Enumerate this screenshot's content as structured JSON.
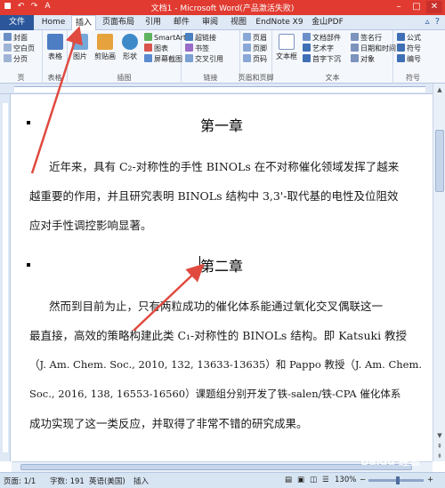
{
  "window": {
    "title": "文档1 - Microsoft Word(产品激活失败)",
    "controls": [
      "minimize",
      "restore",
      "close"
    ]
  },
  "quick_access": [
    "save-icon",
    "undo-icon",
    "redo-icon",
    "format-icon"
  ],
  "tabs": [
    {
      "label": "文件"
    },
    {
      "label": "Home"
    },
    {
      "label": "插入"
    },
    {
      "label": "页面布局"
    },
    {
      "label": "引用"
    },
    {
      "label": "邮件"
    },
    {
      "label": "审阅"
    },
    {
      "label": "视图"
    },
    {
      "label": "EndNote X9"
    },
    {
      "label": "金山PDF"
    }
  ],
  "active_tab": "插入",
  "ribbon": {
    "pages": {
      "label": "页",
      "items": [
        "封面",
        "空白页",
        "分页"
      ]
    },
    "tables": {
      "label": "表格",
      "items": [
        "表格"
      ]
    },
    "illustrations": {
      "label": "插图",
      "items": [
        "图片",
        "剪贴画",
        "形状",
        "SmartArt",
        "图表",
        "屏幕截图"
      ]
    },
    "links": {
      "label": "链接",
      "items": [
        "超链接",
        "书签",
        "交叉引用"
      ]
    },
    "header_footer": {
      "label": "页眉和页脚",
      "items": [
        "页眉",
        "页脚",
        "页码"
      ]
    },
    "text": {
      "label": "文本",
      "items": [
        "文本框",
        "文档部件",
        "艺术字",
        "首字下沉",
        "签名行",
        "日期和时间",
        "对象"
      ]
    },
    "symbols": {
      "label": "符号",
      "items": [
        "公式",
        "符号",
        "编号"
      ]
    }
  },
  "document": {
    "heading1": "第一章",
    "para1": [
      "近年来，具有 C₂-对称性的手性 BINOLs 在不对称催化领域发挥了越来",
      "越重要的作用，并且研究表明 BINOLs 结构中 3,3'-取代基的电性及位阻效",
      "应对手性调控影响显著。"
    ],
    "heading2": "第二章",
    "para2": [
      "然而到目前为止，只有两粒成功的催化体系能通过氧化交叉偶联这一",
      "最直接，高效的策略构建此类 C₁-对称性的 BINOLs 结构。即 Katsuki 教授",
      "（J. Am. Chem. Soc., 2010, 132, 13633-13635）和 Pappo 教授（J. Am. Chem.",
      "Soc., 2016, 138, 16553-16560）课题组分别开发了铁-salen/铁-CPA 催化体系",
      "成功实现了这一类反应，并取得了非常不错的研究成果。"
    ]
  },
  "status_bar": {
    "page": "页面: 1/1",
    "words": "字数: 191",
    "language": "英语(美国)",
    "mode": "插入",
    "zoom": "130%",
    "zoom_value": 130
  },
  "watermark": "Baidu 经验",
  "colors": {
    "title_bar": "#e13a30",
    "file_tab": "#2b579a",
    "annotation_arrow": "#e04a3f"
  }
}
